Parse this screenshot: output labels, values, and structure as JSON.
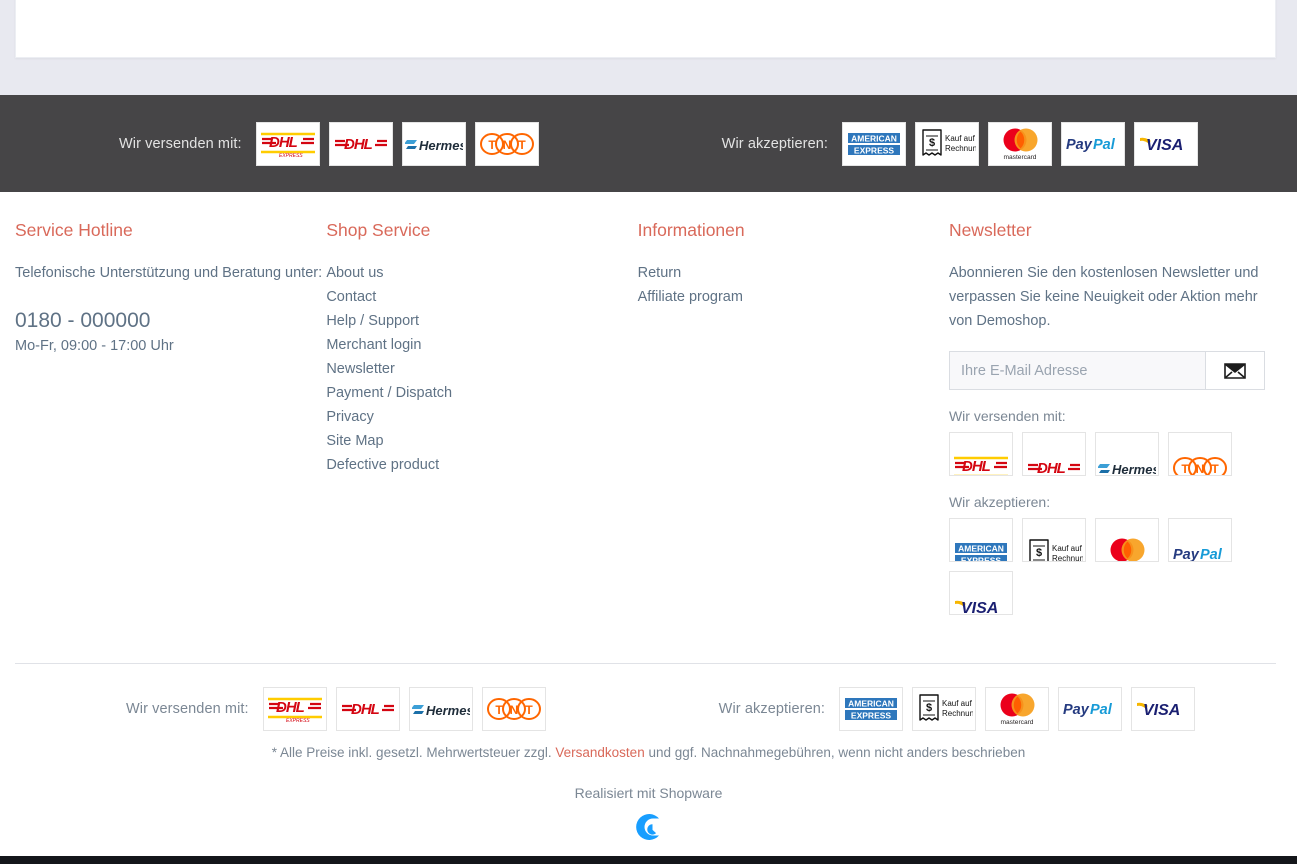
{
  "trust_bar": {
    "shipping_label": "Wir versenden mit:",
    "payment_label": "Wir akzeptieren:",
    "shipping_logos": [
      "dhl-express-logo",
      "dhl-logo",
      "hermes-logo",
      "tnt-logo"
    ],
    "payment_logos": [
      "american-express-logo",
      "kauf-auf-rechnung-logo",
      "mastercard-logo",
      "paypal-logo",
      "visa-logo"
    ]
  },
  "footer": {
    "service_hotline": {
      "title": "Service Hotline",
      "text": "Telefonische Unterstützung und Beratung unter:",
      "phone": "0180 - 000000",
      "hours": "Mo-Fr, 09:00 - 17:00 Uhr"
    },
    "shop_service": {
      "title": "Shop Service",
      "links": [
        "About us",
        "Contact",
        "Help / Support",
        "Merchant login",
        "Newsletter",
        "Payment / Dispatch",
        "Privacy",
        "Site Map",
        "Defective product"
      ]
    },
    "informationen": {
      "title": "Informationen",
      "links": [
        "Return",
        "Affiliate program"
      ]
    },
    "newsletter": {
      "title": "Newsletter",
      "text": "Abonnieren Sie den kostenlosen Newsletter und verpassen Sie keine Neuigkeit oder Aktion mehr von Demoshop.",
      "input_placeholder": "Ihre E-Mail Adresse",
      "input_value": "",
      "submit_icon": "envelope-icon",
      "shipping_label": "Wir versenden mit:",
      "payment_label": "Wir akzeptieren:",
      "shipping_logos": [
        "dhl-express-logo",
        "dhl-logo",
        "hermes-logo",
        "tnt-logo"
      ],
      "payment_logos": [
        "american-express-logo",
        "kauf-auf-rechnung-logo",
        "mastercard-logo",
        "paypal-logo",
        "visa-logo"
      ]
    }
  },
  "bottom": {
    "shipping_label": "Wir versenden mit:",
    "payment_label": "Wir akzeptieren:",
    "shipping_logos": [
      "dhl-express-logo",
      "dhl-logo",
      "hermes-logo",
      "tnt-logo"
    ],
    "payment_logos": [
      "american-express-logo",
      "kauf-auf-rechnung-logo",
      "mastercard-logo",
      "paypal-logo",
      "visa-logo"
    ],
    "legal_prefix": "* Alle Preise inkl. gesetzl. Mehrwertsteuer zzgl. ",
    "legal_link": "Versandkosten",
    "legal_suffix": " und ggf. Nachnahmegebühren, wenn nicht anders beschrieben",
    "realised": "Realisiert mit Shopware",
    "shopware_logo": "shopware-logo"
  },
  "colors": {
    "accent": "#d9695a",
    "dark_bar": "#464547",
    "text": "#5f7285",
    "page_bg": "#e8e9f0",
    "shopware_blue": "#189eff"
  }
}
